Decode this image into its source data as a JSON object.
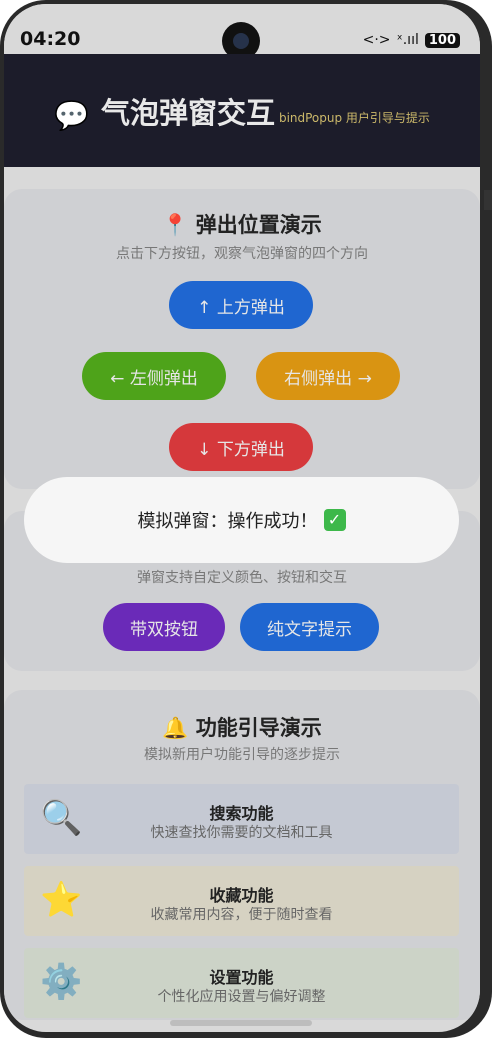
{
  "status": {
    "time": "04:20",
    "network": "<·>",
    "signal": "ˣ.ııl",
    "battery": "100"
  },
  "header": {
    "icon": "💬",
    "title": "气泡弹窗交互",
    "subtitle": "bindPopup 用户引导与提示"
  },
  "section1": {
    "icon": "📍",
    "title": "弹出位置演示",
    "subtitle": "点击下方按钮，观察气泡弹窗的四个方向",
    "btn_top": "↑ 上方弹出",
    "btn_left": "← 左侧弹出",
    "btn_right": "右侧弹出 →",
    "btn_bottom": "↓ 下方弹出"
  },
  "section2": {
    "subtitle": "弹窗支持自定义颜色、按钮和交互",
    "btn_dual": "带双按钮",
    "btn_text": "纯文字提示"
  },
  "section3": {
    "icon": "🔔",
    "title": "功能引导演示",
    "subtitle": "模拟新用户功能引导的逐步提示",
    "items": [
      {
        "icon": "🔍",
        "title": "搜索功能",
        "desc": "快速查找你需要的文档和工具"
      },
      {
        "icon": "⭐",
        "title": "收藏功能",
        "desc": "收藏常用内容，便于随时查看"
      },
      {
        "icon": "⚙️",
        "title": "设置功能",
        "desc": "个性化应用设置与偏好调整"
      }
    ]
  },
  "toast": {
    "message": "模拟弹窗：操作成功！",
    "check": "✓"
  },
  "colors": {
    "blue": "#1f66d0",
    "green": "#4ea31a",
    "orange": "#d99412",
    "red": "#d5383b",
    "purple": "#6a2ab8"
  }
}
